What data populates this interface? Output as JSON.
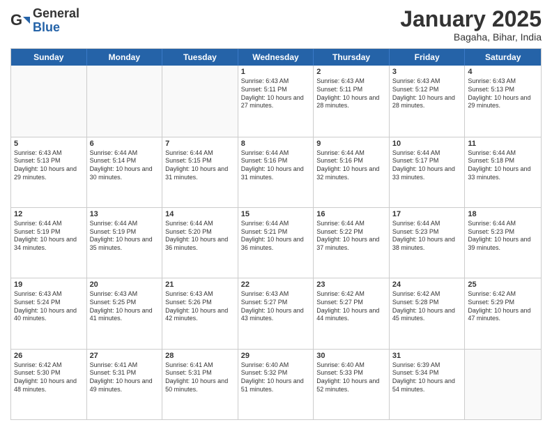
{
  "logo": {
    "general": "General",
    "blue": "Blue"
  },
  "header": {
    "month": "January 2025",
    "location": "Bagaha, Bihar, India"
  },
  "days": [
    "Sunday",
    "Monday",
    "Tuesday",
    "Wednesday",
    "Thursday",
    "Friday",
    "Saturday"
  ],
  "weeks": [
    [
      {
        "date": "",
        "empty": true
      },
      {
        "date": "",
        "empty": true
      },
      {
        "date": "",
        "empty": true
      },
      {
        "date": "1",
        "sunrise": "6:43 AM",
        "sunset": "5:11 PM",
        "daylight": "10 hours and 27 minutes."
      },
      {
        "date": "2",
        "sunrise": "6:43 AM",
        "sunset": "5:11 PM",
        "daylight": "10 hours and 28 minutes."
      },
      {
        "date": "3",
        "sunrise": "6:43 AM",
        "sunset": "5:12 PM",
        "daylight": "10 hours and 28 minutes."
      },
      {
        "date": "4",
        "sunrise": "6:43 AM",
        "sunset": "5:13 PM",
        "daylight": "10 hours and 29 minutes."
      }
    ],
    [
      {
        "date": "5",
        "sunrise": "6:43 AM",
        "sunset": "5:13 PM",
        "daylight": "10 hours and 29 minutes."
      },
      {
        "date": "6",
        "sunrise": "6:44 AM",
        "sunset": "5:14 PM",
        "daylight": "10 hours and 30 minutes."
      },
      {
        "date": "7",
        "sunrise": "6:44 AM",
        "sunset": "5:15 PM",
        "daylight": "10 hours and 31 minutes."
      },
      {
        "date": "8",
        "sunrise": "6:44 AM",
        "sunset": "5:16 PM",
        "daylight": "10 hours and 31 minutes."
      },
      {
        "date": "9",
        "sunrise": "6:44 AM",
        "sunset": "5:16 PM",
        "daylight": "10 hours and 32 minutes."
      },
      {
        "date": "10",
        "sunrise": "6:44 AM",
        "sunset": "5:17 PM",
        "daylight": "10 hours and 33 minutes."
      },
      {
        "date": "11",
        "sunrise": "6:44 AM",
        "sunset": "5:18 PM",
        "daylight": "10 hours and 33 minutes."
      }
    ],
    [
      {
        "date": "12",
        "sunrise": "6:44 AM",
        "sunset": "5:19 PM",
        "daylight": "10 hours and 34 minutes."
      },
      {
        "date": "13",
        "sunrise": "6:44 AM",
        "sunset": "5:19 PM",
        "daylight": "10 hours and 35 minutes."
      },
      {
        "date": "14",
        "sunrise": "6:44 AM",
        "sunset": "5:20 PM",
        "daylight": "10 hours and 36 minutes."
      },
      {
        "date": "15",
        "sunrise": "6:44 AM",
        "sunset": "5:21 PM",
        "daylight": "10 hours and 36 minutes."
      },
      {
        "date": "16",
        "sunrise": "6:44 AM",
        "sunset": "5:22 PM",
        "daylight": "10 hours and 37 minutes."
      },
      {
        "date": "17",
        "sunrise": "6:44 AM",
        "sunset": "5:23 PM",
        "daylight": "10 hours and 38 minutes."
      },
      {
        "date": "18",
        "sunrise": "6:44 AM",
        "sunset": "5:23 PM",
        "daylight": "10 hours and 39 minutes."
      }
    ],
    [
      {
        "date": "19",
        "sunrise": "6:43 AM",
        "sunset": "5:24 PM",
        "daylight": "10 hours and 40 minutes."
      },
      {
        "date": "20",
        "sunrise": "6:43 AM",
        "sunset": "5:25 PM",
        "daylight": "10 hours and 41 minutes."
      },
      {
        "date": "21",
        "sunrise": "6:43 AM",
        "sunset": "5:26 PM",
        "daylight": "10 hours and 42 minutes."
      },
      {
        "date": "22",
        "sunrise": "6:43 AM",
        "sunset": "5:27 PM",
        "daylight": "10 hours and 43 minutes."
      },
      {
        "date": "23",
        "sunrise": "6:42 AM",
        "sunset": "5:27 PM",
        "daylight": "10 hours and 44 minutes."
      },
      {
        "date": "24",
        "sunrise": "6:42 AM",
        "sunset": "5:28 PM",
        "daylight": "10 hours and 45 minutes."
      },
      {
        "date": "25",
        "sunrise": "6:42 AM",
        "sunset": "5:29 PM",
        "daylight": "10 hours and 47 minutes."
      }
    ],
    [
      {
        "date": "26",
        "sunrise": "6:42 AM",
        "sunset": "5:30 PM",
        "daylight": "10 hours and 48 minutes."
      },
      {
        "date": "27",
        "sunrise": "6:41 AM",
        "sunset": "5:31 PM",
        "daylight": "10 hours and 49 minutes."
      },
      {
        "date": "28",
        "sunrise": "6:41 AM",
        "sunset": "5:31 PM",
        "daylight": "10 hours and 50 minutes."
      },
      {
        "date": "29",
        "sunrise": "6:40 AM",
        "sunset": "5:32 PM",
        "daylight": "10 hours and 51 minutes."
      },
      {
        "date": "30",
        "sunrise": "6:40 AM",
        "sunset": "5:33 PM",
        "daylight": "10 hours and 52 minutes."
      },
      {
        "date": "31",
        "sunrise": "6:39 AM",
        "sunset": "5:34 PM",
        "daylight": "10 hours and 54 minutes."
      },
      {
        "date": "",
        "empty": true
      }
    ]
  ]
}
